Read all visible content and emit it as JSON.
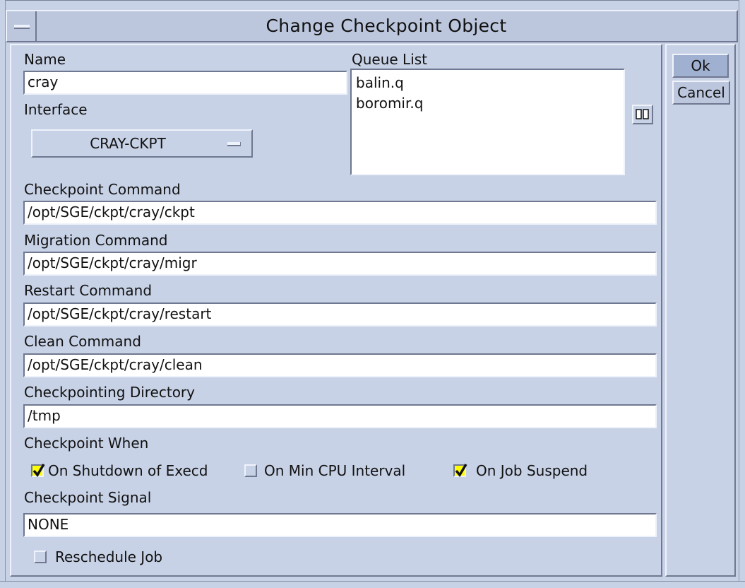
{
  "window": {
    "title": "Change Checkpoint Object"
  },
  "name": {
    "label": "Name",
    "value": "cray"
  },
  "interface": {
    "label": "Interface",
    "selected": "CRAY-CKPT"
  },
  "queue_list": {
    "label": "Queue List",
    "items": [
      "balin.q",
      "boromir.q"
    ]
  },
  "checkpoint_command": {
    "label": "Checkpoint Command",
    "value": "/opt/SGE/ckpt/cray/ckpt"
  },
  "migration_command": {
    "label": "Migration Command",
    "value": "/opt/SGE/ckpt/cray/migr"
  },
  "restart_command": {
    "label": "Restart Command",
    "value": "/opt/SGE/ckpt/cray/restart"
  },
  "clean_command": {
    "label": "Clean Command",
    "value": "/opt/SGE/ckpt/cray/clean"
  },
  "checkpointing_directory": {
    "label": "Checkpointing Directory",
    "value": "/tmp"
  },
  "checkpoint_when": {
    "label": "Checkpoint When",
    "options": [
      {
        "label": "On Shutdown of Execd",
        "checked": true
      },
      {
        "label": "On Min CPU Interval",
        "checked": false
      },
      {
        "label": "On Job Suspend",
        "checked": true
      }
    ]
  },
  "checkpoint_signal": {
    "label": "Checkpoint Signal",
    "value": "NONE"
  },
  "reschedule_job": {
    "label": "Reschedule Job",
    "checked": false
  },
  "buttons": {
    "ok": "Ok",
    "cancel": "Cancel"
  },
  "icons": {
    "window_menu": "window-menu-icon",
    "queue_browse": "queue-browse-icon",
    "check": "check-icon"
  },
  "colors": {
    "background": "#c8d2e6",
    "checkbox_checked": "#ffff00",
    "default_button": "#9fb0d0"
  }
}
